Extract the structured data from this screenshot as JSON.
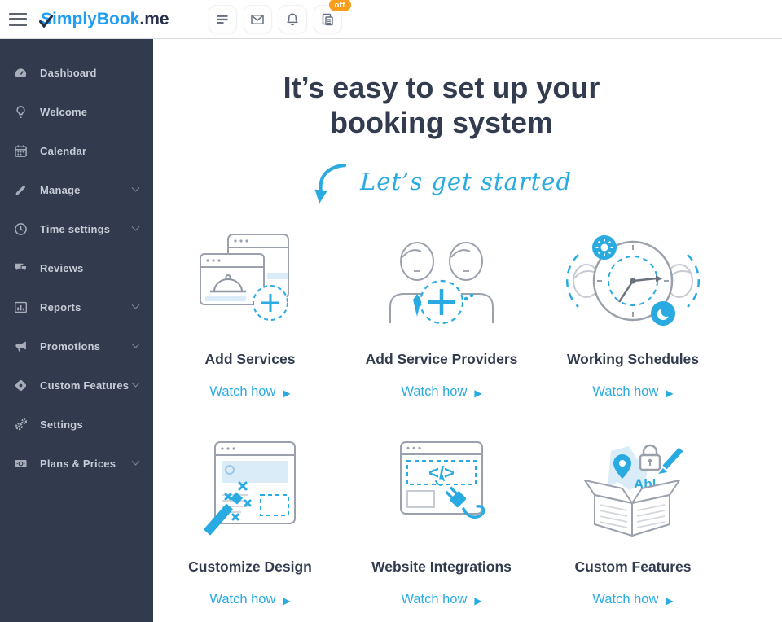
{
  "header": {
    "logo": {
      "part1": "SimplyBook",
      "part2": ".me"
    },
    "buttons": [
      {
        "icon": "list-icon"
      },
      {
        "icon": "mail-icon"
      },
      {
        "icon": "bell-icon"
      },
      {
        "icon": "report-icon",
        "badge": "off"
      }
    ]
  },
  "sidebar": {
    "items": [
      {
        "label": "Dashboard",
        "expandable": false
      },
      {
        "label": "Welcome",
        "expandable": false
      },
      {
        "label": "Calendar",
        "expandable": false
      },
      {
        "label": "Manage",
        "expandable": true
      },
      {
        "label": "Time settings",
        "expandable": true
      },
      {
        "label": "Reviews",
        "expandable": false
      },
      {
        "label": "Reports",
        "expandable": true
      },
      {
        "label": "Promotions",
        "expandable": true
      },
      {
        "label": "Custom Features",
        "expandable": true
      },
      {
        "label": "Settings",
        "expandable": false
      },
      {
        "label": "Plans & Prices",
        "expandable": true
      }
    ]
  },
  "main": {
    "title_line1": "It’s easy to set up your",
    "title_line2": "booking system",
    "subtitle": "Let’s get started",
    "play_glyph": "▶",
    "tiles": [
      {
        "title": "Add Services",
        "link": "Watch how"
      },
      {
        "title": "Add Service Providers",
        "link": "Watch how"
      },
      {
        "title": "Working Schedules",
        "link": "Watch how"
      },
      {
        "title": "Customize Design",
        "link": "Watch how"
      },
      {
        "title": "Website Integrations",
        "link": "Watch how"
      },
      {
        "title": "Custom Features",
        "link": "Watch how"
      }
    ]
  },
  "colors": {
    "accent_blue": "#29abe2",
    "logo_blue": "#219df4",
    "navy_text": "#333b4f",
    "sidebar_bg": "#323b4d",
    "badge_orange": "#f89e1c",
    "illustration_gray": "#9aa1ad",
    "illustration_light_blue": "#d9ecf8"
  }
}
